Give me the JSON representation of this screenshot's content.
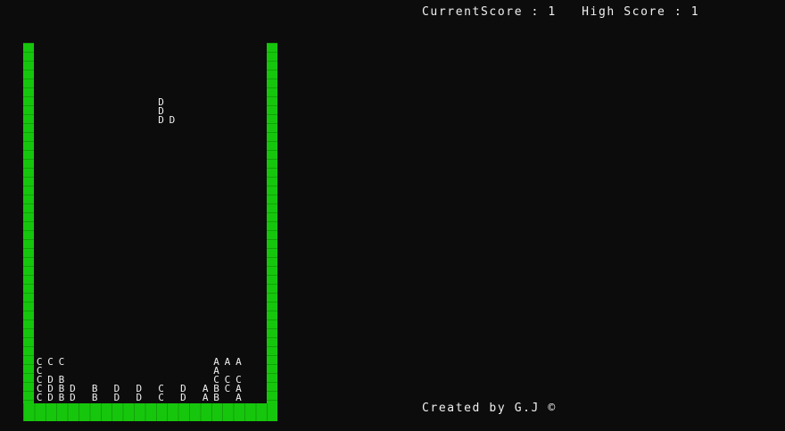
{
  "hud": {
    "current_label": "CurrentScore",
    "current_value": "1",
    "high_label": "High Score",
    "high_value": "1"
  },
  "footer": {
    "credit": "Created by G.J ©"
  },
  "colors": {
    "background": "#0c0c0c",
    "wall": "#16c60c",
    "text": "#f0f0f0"
  },
  "active_piece": [
    "D ",
    "D ",
    "DD"
  ],
  "stack": [
    "CCC             AAA",
    "C               A  ",
    "CDB             CCC",
    "CDBD B D D C D ABCA",
    "CDBD B D D C D AB A"
  ]
}
